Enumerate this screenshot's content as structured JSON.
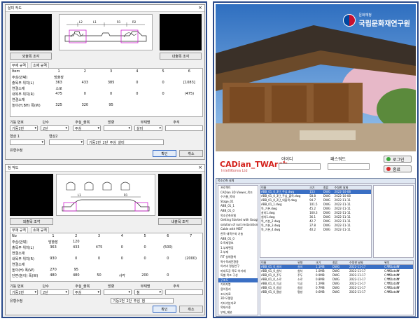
{
  "dialogA": {
    "title": "살미 작도",
    "close": "×",
    "btn_left": "외출목 조각",
    "btn_right": "내출목 조각",
    "tabs": [
      "부재 규격",
      "소재 규격"
    ],
    "grid": [
      [
        "Item",
        "1",
        "2",
        "3",
        "4",
        "5",
        "6"
      ],
      [
        "주심(안팎)",
        "방출장",
        "",
        "",
        "",
        "",
        ""
      ],
      [
        "출목부 위치(L)",
        "363",
        "433",
        "385",
        "0",
        "0",
        "[1083]"
      ],
      [
        "연결소재",
        "소로",
        "",
        "",
        "",
        "",
        ""
      ],
      [
        "내목부 위치(R)",
        "475",
        "0",
        "0",
        "0",
        "0",
        "(475)"
      ],
      [
        "연결소재",
        "",
        "",
        "",
        "",
        "",
        ""
      ],
      [
        "높이(H,BH) 폭(W)",
        "325",
        "320",
        "95",
        "",
        "",
        ""
      ]
    ],
    "form_labels": [
      "기둥 번호",
      "단수",
      "주심_출목",
      "방향",
      "부재명",
      "주석"
    ],
    "form_values": [
      "기둥1번",
      "2단",
      "주심",
      "",
      "살미",
      ""
    ],
    "shape1_label": "형상 1",
    "shape2_label": "형상2",
    "name_value": "기둥1번_2단_주심_살미",
    "tag_label": "유형수정",
    "ok": "확인",
    "cancel": "취소",
    "dims": [
      "L2",
      "L1",
      "R1",
      "R2"
    ]
  },
  "dialogB": {
    "title": "첨 작도",
    "close": "×",
    "btn_left": "외출목 조각",
    "btn_right": "내출목 조각",
    "tabs": [
      "부재 규격",
      "소재 규격"
    ],
    "grid": [
      [
        "No",
        "1",
        "2",
        "3",
        "4",
        "5",
        "6",
        "7"
      ],
      [
        "주심(안팎)",
        "방출장",
        "120",
        "",
        "",
        "",
        "",
        ""
      ],
      [
        "출목부 위치(L)",
        "363",
        "433",
        "475",
        "0",
        "0",
        "(500)",
        ""
      ],
      [
        "연결소재",
        "",
        "",
        "",
        "",
        "",
        "",
        ""
      ],
      [
        "내목부 위치(R)",
        "930",
        "0",
        "0",
        "0",
        "0",
        "0",
        "(2000)"
      ],
      [
        "연결소재",
        "",
        "",
        "",
        "",
        "",
        "",
        ""
      ],
      [
        "높이(H) 폭(W)",
        "270",
        "95",
        "",
        "",
        "",
        "",
        ""
      ],
      [
        "단면(높이) 폭(W)",
        "480",
        "480",
        "50",
        "사각",
        "200",
        "0",
        ""
      ]
    ],
    "form_labels": [
      "기둥 번호",
      "단수",
      "주심_출목",
      "방향",
      "부재명",
      "주석"
    ],
    "form_values": [
      "기둥1번",
      "2단",
      "주심",
      "",
      "첨",
      ""
    ],
    "name_value": "기둥1번_2단_주심_첨",
    "tag_label": "유형수정",
    "ok": "확인",
    "cancel": "취소",
    "dims": [
      "L1",
      "R1"
    ]
  },
  "right": {
    "logo_small": "문화재청",
    "logo_big": "국립문화재연구원",
    "app_name": "CADian_TWArch",
    "company": "IntelliKorea Ltd",
    "id_label": "아이디",
    "pw_label": "패스워드",
    "login_btn": "로그인",
    "exit_btn": "종료",
    "app_title": "목조건축 설계",
    "tree_items": [
      "프로젝트",
      "CADian 3D Viewer_목조",
      "수가물_목재",
      "Stage_01",
      "ABB_01_1",
      "ABB_01_0",
      "목조건축모델",
      "Getting Started with Google",
      "solution of rust restoration",
      "Cable with MEIT",
      "한옥-대목수와 기술",
      "ABB_01_0",
      "0.목재정보",
      "1.부재편집",
      "2.부재",
      "FIT 실해결책",
      "특수목재전환용",
      "아키바 명칭연구",
      "마대도공 목도-아키재",
      "특별 목조 구성",
      "구조도",
      "기와지붕",
      "용어정리",
      "조사자료",
      "3D 모델링",
      "기타기본자료",
      "목재수종",
      "부재_제본",
      "2021_예제",
      "2021_이전"
    ],
    "file_head": [
      "이름",
      "크기",
      "종류",
      "수정한 날짜"
    ],
    "files": [
      [
        "ABB_01_0_3단_주심.dwg",
        "153",
        "DWG",
        "2022-10-08"
      ],
      [
        "ABB_01_0_3단_주심_출목.dwg",
        "58.8",
        "DWG",
        "2022-10-08"
      ],
      [
        "ABB_01_0_2단_외출목.dwg",
        "94.7",
        "DWG",
        "2022-11-11"
      ],
      [
        "ABB_01_1.dwg",
        "101.5",
        "DWG",
        "2022-11-11"
      ],
      [
        "목_기본.dwg",
        "45.2",
        "DWG",
        "2022-11-11"
      ],
      [
        "살미1.dwg",
        "160.3",
        "DWG",
        "2022-11-11"
      ],
      [
        "첨차1.dwg",
        "36.1",
        "DWG",
        "2022-11-11"
      ],
      [
        "목_기본_2.dwg",
        "42.7",
        "DWG",
        "2022-11-11"
      ],
      [
        "목_기본_3.dwg",
        "37.8",
        "DWG",
        "2022-11-11"
      ],
      [
        "목_기본_4.dwg",
        "40.2",
        "DWG",
        "2022-11-11"
      ]
    ],
    "bottom_head": [
      "이름",
      "유형",
      "크기",
      "종류",
      "수정한 날짜",
      "위치"
    ],
    "bottom_rows": [
      [
        "ABB_01_0_살미",
        "살미",
        "1.1MB",
        "DWG",
        "2022-11-17",
        "C:₩Data₩"
      ],
      [
        "ABB_01_0_첨차",
        "첨차",
        "1.0MB",
        "DWG",
        "2022-11-17",
        "C:₩Data₩"
      ],
      [
        "ABB_01_0_주두",
        "주두",
        "0.9MB",
        "DWG",
        "2022-11-17",
        "C:₩Data₩"
      ],
      [
        "ABB_01_0_소로",
        "소로",
        "0.8MB",
        "DWG",
        "2022-11-17",
        "C:₩Data₩"
      ],
      [
        "ABB_01_0_익공",
        "익공",
        "1.2MB",
        "DWG",
        "2022-11-17",
        "C:₩Data₩"
      ],
      [
        "ABB_01_0_창방",
        "창방",
        "0.7MB",
        "DWG",
        "2022-11-17",
        "C:₩Data₩"
      ],
      [
        "ABB_01_0_평방",
        "평방",
        "0.6MB",
        "DWG",
        "2022-11-17",
        "C:₩Data₩"
      ]
    ]
  }
}
